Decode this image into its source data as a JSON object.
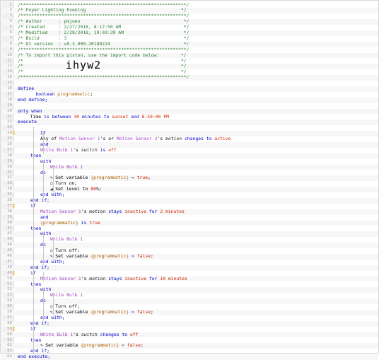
{
  "lines": [
    {
      "n": "1",
      "text": "/*************************************************************/",
      "cls": "c-comment"
    },
    {
      "n": "2",
      "text": "/* Foyer Lighting Evening                                   */",
      "cls": "c-comment"
    },
    {
      "n": "3",
      "text": "/*************************************************************/",
      "cls": "c-comment"
    },
    {
      "n": "4",
      "text": "/* Author      : pmjoen                                      */",
      "cls": "c-comment"
    },
    {
      "n": "5",
      "text": "/* Created     : 2/27/2018, 8:12:50 AM                       */",
      "cls": "c-comment"
    },
    {
      "n": "6",
      "text": "/* Modified    : 2/28/2018, 10:03:39 AM                      */",
      "cls": "c-comment"
    },
    {
      "n": "7",
      "text": "/* Build       : 3                                           */",
      "cls": "c-comment"
    },
    {
      "n": "8",
      "text": "/* UI version  : v0.3.000.20180224                           */",
      "cls": "c-comment"
    },
    {
      "n": "9",
      "text": "/*************************************************************/",
      "cls": "c-comment"
    },
    {
      "n": "10",
      "text": "/* To import this piston, use the import code below:        */",
      "cls": "c-comment"
    },
    {
      "n": "11",
      "text": "/*                                                          */",
      "cls": "c-comment"
    },
    {
      "n": "12",
      "text": "/*                                                          */",
      "cls": "c-comment"
    },
    {
      "n": "13",
      "text": "/*                                                          */",
      "cls": "c-comment"
    },
    {
      "n": "14",
      "text": "/*************************************************************/",
      "cls": "c-comment"
    },
    {
      "n": "15",
      "text": "",
      "cls": ""
    },
    {
      "n": "16",
      "text": "define",
      "cls": "c-kw"
    },
    {
      "n": "17",
      "text": "",
      "cls": ""
    },
    {
      "n": "18",
      "text": "end define;",
      "cls": "c-kw"
    },
    {
      "n": "19",
      "text": "",
      "cls": ""
    },
    {
      "n": "20",
      "text": "only when",
      "cls": "c-kw"
    },
    {
      "n": "21",
      "text": "",
      "cls": ""
    },
    {
      "n": "22",
      "text": "execute",
      "cls": "c-kw"
    },
    {
      "n": "23",
      "text": "",
      "cls": ""
    },
    {
      "n": "24",
      "text": "",
      "cls": ""
    },
    {
      "n": "25",
      "text": "",
      "cls": ""
    },
    {
      "n": "26",
      "text": "",
      "cls": ""
    },
    {
      "n": "27",
      "text": "",
      "cls": ""
    },
    {
      "n": "28",
      "text": "",
      "cls": ""
    },
    {
      "n": "29",
      "text": "",
      "cls": ""
    },
    {
      "n": "30",
      "text": "",
      "cls": ""
    },
    {
      "n": "31",
      "text": "",
      "cls": ""
    },
    {
      "n": "32",
      "text": "",
      "cls": ""
    },
    {
      "n": "33",
      "text": "",
      "cls": ""
    },
    {
      "n": "34",
      "text": "",
      "cls": ""
    },
    {
      "n": "35",
      "text": "",
      "cls": ""
    },
    {
      "n": "36",
      "text": "",
      "cls": ""
    },
    {
      "n": "37",
      "text": "",
      "cls": ""
    },
    {
      "n": "38",
      "text": "",
      "cls": ""
    },
    {
      "n": "39",
      "text": "",
      "cls": ""
    },
    {
      "n": "40",
      "text": "",
      "cls": ""
    },
    {
      "n": "41",
      "text": "",
      "cls": ""
    },
    {
      "n": "42",
      "text": "",
      "cls": ""
    },
    {
      "n": "43",
      "text": "",
      "cls": ""
    },
    {
      "n": "44",
      "text": "",
      "cls": ""
    },
    {
      "n": "45",
      "text": "",
      "cls": ""
    },
    {
      "n": "46",
      "text": "",
      "cls": ""
    },
    {
      "n": "47",
      "text": "",
      "cls": ""
    },
    {
      "n": "48",
      "text": "",
      "cls": ""
    },
    {
      "n": "49",
      "text": "",
      "cls": ""
    },
    {
      "n": "50",
      "text": "",
      "cls": ""
    },
    {
      "n": "51",
      "text": "",
      "cls": ""
    },
    {
      "n": "52",
      "text": "",
      "cls": ""
    },
    {
      "n": "53",
      "text": "",
      "cls": ""
    },
    {
      "n": "54",
      "text": "",
      "cls": ""
    },
    {
      "n": "55",
      "text": "",
      "cls": ""
    },
    {
      "n": "56",
      "text": "",
      "cls": ""
    },
    {
      "n": "57",
      "text": "",
      "cls": ""
    },
    {
      "n": "58",
      "text": "",
      "cls": ""
    },
    {
      "n": "59",
      "text": "",
      "cls": ""
    },
    {
      "n": "60",
      "text": "",
      "cls": ""
    },
    {
      "n": "61",
      "text": "",
      "cls": ""
    },
    {
      "n": "62",
      "text": "",
      "cls": ""
    }
  ],
  "import_code": "ihyw2",
  "code": {
    "l17": [
      "    ",
      "boolean ",
      "programmatic",
      ";"
    ],
    "l21": [
      "  Time ",
      "is between ",
      "30",
      " minutes ",
      "to ",
      "sunset",
      " and ",
      "8:59:00 PM"
    ],
    "l24": [
      "If"
    ],
    "l25": [
      "Any of ",
      "Motion Sensor 1",
      "'s or ",
      "Motion Sensor 2",
      "'s ",
      "motion",
      " changes to ",
      "active"
    ],
    "l26": [
      "and"
    ],
    "l27": [
      "White Bulb 1",
      "'s ",
      "switch",
      " is ",
      "off"
    ],
    "l28": [
      "then"
    ],
    "l29": [
      "with"
    ],
    "l30": [
      "White Bulb 1"
    ],
    "l31": [
      "do"
    ],
    "l32": [
      "Set variable ",
      "{programmatic}",
      " = ",
      "true",
      ";"
    ],
    "l33": [
      "Turn on;"
    ],
    "l34": [
      "Set level to ",
      "80",
      "%;"
    ],
    "l35": [
      "end with;"
    ],
    "l36": [
      "end if;"
    ],
    "l37": [
      "if"
    ],
    "l38": [
      "Motion Sensor 1",
      "'s ",
      "motion",
      " stays ",
      "inactive",
      " for ",
      "2 minutes"
    ],
    "l39": [
      "and"
    ],
    "l40": [
      "{programmatic}",
      " is ",
      "true"
    ],
    "l41": [
      "then"
    ],
    "l42": [
      "with"
    ],
    "l43": [
      "White Bulb 1"
    ],
    "l44": [
      "do"
    ],
    "l45": [
      "Turn off;"
    ],
    "l46": [
      "Set variable ",
      "{programmatic}",
      " = ",
      "false",
      ";"
    ],
    "l47": [
      "end with;"
    ],
    "l48": [
      "end if;"
    ],
    "l49": [
      "if"
    ],
    "l50": [
      "Motion Sensor 1",
      "'s ",
      "motion",
      " stays ",
      "inactive",
      " for ",
      "10 minutes"
    ],
    "l51": [
      "then"
    ],
    "l52": [
      "with"
    ],
    "l53": [
      "White Bulb 1"
    ],
    "l54": [
      "do"
    ],
    "l55": [
      "Turn off;"
    ],
    "l56": [
      "Set variable ",
      "{programmatic}",
      " = ",
      "false",
      ";"
    ],
    "l57": [
      "end with;"
    ],
    "l58": [
      "end if;"
    ],
    "l59": [
      "if"
    ],
    "l60": [
      "White Bulb 1",
      "'s ",
      "switch",
      " changes to ",
      "off"
    ],
    "l61": [
      "then"
    ],
    "l62": [
      "Set variable ",
      "{programmatic}",
      " = ",
      "false",
      ";"
    ],
    "l63": [
      "end if;"
    ],
    "l64": [
      "end execute;"
    ]
  },
  "colors": {
    "comment": "#2e7d32",
    "keyword": "#0000c8",
    "device": "#a640c8",
    "value": "#cc2200",
    "variable": "#b06000"
  }
}
